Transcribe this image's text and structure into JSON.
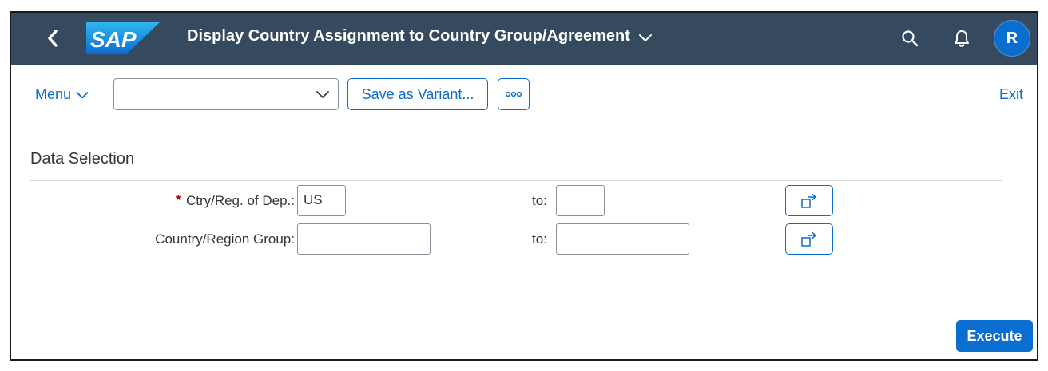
{
  "shell": {
    "logo_text": "SAP",
    "title": "Display Country Assignment to Country Group/Agreement",
    "avatar_initial": "R",
    "icons": [
      "back-icon",
      "chevron-down-icon",
      "search-icon",
      "bell-icon"
    ]
  },
  "toolbar": {
    "menu_label": "Menu",
    "variant_value": "",
    "save_variant_label": "Save as Variant...",
    "more_icon": "overflow-icon",
    "exit_label": "Exit"
  },
  "selection": {
    "title": "Data Selection",
    "fields": [
      {
        "label": "Ctry/Reg. of Dep.:",
        "required": true,
        "from": "US",
        "to_label": "to:",
        "to": ""
      },
      {
        "label": "Country/Region Group:",
        "required": false,
        "from": "",
        "to_label": "to:",
        "to": ""
      }
    ],
    "required_marker": "*"
  },
  "footer": {
    "execute_label": "Execute"
  },
  "colors": {
    "shell_bg": "#354a5f",
    "accent": "#0a6ed1",
    "required": "#bb0000"
  }
}
